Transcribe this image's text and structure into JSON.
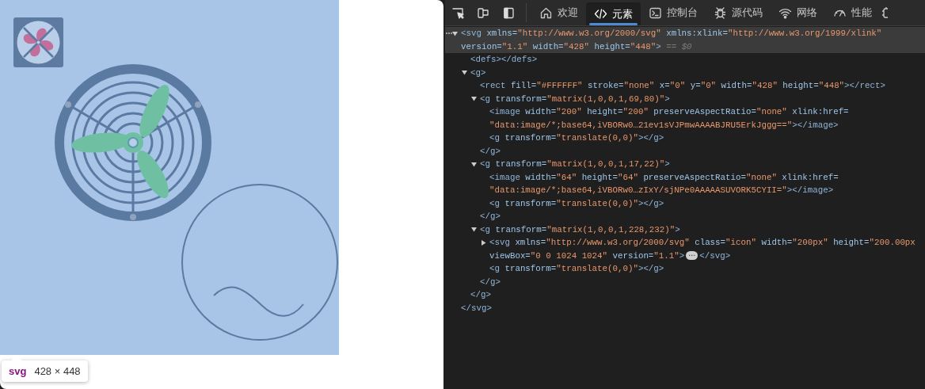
{
  "preview": {
    "tooltip": {
      "tag": "svg",
      "size": "428 × 448"
    }
  },
  "devtools": {
    "tabs": [
      {
        "label": "欢迎",
        "selected": false
      },
      {
        "label": "元素",
        "selected": true
      },
      {
        "label": "控制台",
        "selected": false
      },
      {
        "label": "源代码",
        "selected": false
      },
      {
        "label": "网络",
        "selected": false
      },
      {
        "label": "性能",
        "selected": false
      }
    ],
    "tree": {
      "selected": true,
      "expanded": true,
      "lines": [
        [
          {
            "kind": "tag",
            "text": "<svg"
          },
          {
            "kind": "name",
            "text": "xmlns="
          },
          {
            "kind": "value",
            "text": "\"http://www.w3.org/2000/svg\""
          },
          {
            "kind": "name",
            "text": "xmlns:xlink="
          },
          {
            "kind": "value",
            "text": "\"http://www.w3.org/1999/xlink\""
          }
        ],
        [
          {
            "kind": "name",
            "text": "version="
          },
          {
            "kind": "value",
            "text": "\"1.1\""
          },
          {
            "kind": "name",
            "text": "width="
          },
          {
            "kind": "value",
            "text": "\"428\""
          },
          {
            "kind": "name",
            "text": "height="
          },
          {
            "kind": "value",
            "text": "\"448\""
          },
          {
            "kind": "tag",
            "text": ">"
          },
          {
            "kind": "comment",
            "text": "== $0"
          }
        ]
      ],
      "children": [
        {
          "selected": false,
          "lines": [
            [
              {
                "kind": "tag",
                "text": "<defs"
              },
              {
                "kind": "tag",
                "text": "></defs>"
              }
            ]
          ]
        },
        {
          "selected": false,
          "expanded": true,
          "lines": [
            [
              {
                "kind": "tag",
                "text": "<g"
              },
              {
                "kind": "tag",
                "text": ">"
              }
            ]
          ],
          "children": [
            {
              "selected": false,
              "lines": [
                [
                  {
                    "kind": "tag",
                    "text": "<rect"
                  },
                  {
                    "kind": "name",
                    "text": "fill="
                  },
                  {
                    "kind": "value",
                    "text": "\"#FFFFFF\""
                  },
                  {
                    "kind": "name",
                    "text": "stroke="
                  },
                  {
                    "kind": "value",
                    "text": "\"none\""
                  },
                  {
                    "kind": "name",
                    "text": "x="
                  },
                  {
                    "kind": "value",
                    "text": "\"0\""
                  },
                  {
                    "kind": "name",
                    "text": "y="
                  },
                  {
                    "kind": "value",
                    "text": "\"0\""
                  },
                  {
                    "kind": "name",
                    "text": "width="
                  },
                  {
                    "kind": "value",
                    "text": "\"428\""
                  },
                  {
                    "kind": "name",
                    "text": "height="
                  },
                  {
                    "kind": "value",
                    "text": "\"448\""
                  },
                  {
                    "kind": "tag",
                    "text": "></rect>"
                  }
                ]
              ]
            },
            {
              "selected": false,
              "expanded": true,
              "lines": [
                [
                  {
                    "kind": "tag",
                    "text": "<g"
                  },
                  {
                    "kind": "name",
                    "text": "transform="
                  },
                  {
                    "kind": "value",
                    "text": "\"matrix(1,0,0,1,69,80)\""
                  },
                  {
                    "kind": "tag",
                    "text": ">"
                  }
                ]
              ],
              "children": [
                {
                  "selected": false,
                  "lines": [
                    [
                      {
                        "kind": "tag",
                        "text": "<image"
                      },
                      {
                        "kind": "name",
                        "text": "width="
                      },
                      {
                        "kind": "value",
                        "text": "\"200\""
                      },
                      {
                        "kind": "name",
                        "text": "height="
                      },
                      {
                        "kind": "value",
                        "text": "\"200\""
                      },
                      {
                        "kind": "name",
                        "text": "preserveAspectRatio="
                      },
                      {
                        "kind": "value",
                        "text": "\"none\""
                      },
                      {
                        "kind": "name",
                        "text": "xlink:href="
                      }
                    ],
                    [
                      {
                        "kind": "value",
                        "text": "\"data:image/*;base64,iVBORw0…21ev1sVJPmwAAAABJRU5ErkJggg==\""
                      },
                      {
                        "kind": "tag",
                        "text": "></image>"
                      }
                    ]
                  ]
                },
                {
                  "selected": false,
                  "lines": [
                    [
                      {
                        "kind": "tag",
                        "text": "<g"
                      },
                      {
                        "kind": "name",
                        "text": "transform="
                      },
                      {
                        "kind": "value",
                        "text": "\"translate(0,0)\""
                      },
                      {
                        "kind": "tag",
                        "text": "></g>"
                      }
                    ]
                  ]
                }
              ],
              "closing": [
                {
                  "kind": "tag",
                  "text": "</g>"
                }
              ]
            },
            {
              "selected": false,
              "expanded": true,
              "lines": [
                [
                  {
                    "kind": "tag",
                    "text": "<g"
                  },
                  {
                    "kind": "name",
                    "text": "transform="
                  },
                  {
                    "kind": "value",
                    "text": "\"matrix(1,0,0,1,17,22)\""
                  },
                  {
                    "kind": "tag",
                    "text": ">"
                  }
                ]
              ],
              "children": [
                {
                  "selected": false,
                  "lines": [
                    [
                      {
                        "kind": "tag",
                        "text": "<image"
                      },
                      {
                        "kind": "name",
                        "text": "width="
                      },
                      {
                        "kind": "value",
                        "text": "\"64\""
                      },
                      {
                        "kind": "name",
                        "text": "height="
                      },
                      {
                        "kind": "value",
                        "text": "\"64\""
                      },
                      {
                        "kind": "name",
                        "text": "preserveAspectRatio="
                      },
                      {
                        "kind": "value",
                        "text": "\"none\""
                      },
                      {
                        "kind": "name",
                        "text": "xlink:href="
                      }
                    ],
                    [
                      {
                        "kind": "value",
                        "text": "\"data:image/*;base64,iVBORw0…zIxY/sjNPe0AAAAASUVORK5CYII=\""
                      },
                      {
                        "kind": "tag",
                        "text": "></image>"
                      }
                    ]
                  ]
                },
                {
                  "selected": false,
                  "lines": [
                    [
                      {
                        "kind": "tag",
                        "text": "<g"
                      },
                      {
                        "kind": "name",
                        "text": "transform="
                      },
                      {
                        "kind": "value",
                        "text": "\"translate(0,0)\""
                      },
                      {
                        "kind": "tag",
                        "text": "></g>"
                      }
                    ]
                  ]
                }
              ],
              "closing": [
                {
                  "kind": "tag",
                  "text": "</g>"
                }
              ]
            },
            {
              "selected": false,
              "expanded": true,
              "lines": [
                [
                  {
                    "kind": "tag",
                    "text": "<g"
                  },
                  {
                    "kind": "name",
                    "text": "transform="
                  },
                  {
                    "kind": "value",
                    "text": "\"matrix(1,0,0,1,228,232)\""
                  },
                  {
                    "kind": "tag",
                    "text": ">"
                  }
                ]
              ],
              "children": [
                {
                  "selected": false,
                  "expanded": false,
                  "lines": [
                    [
                      {
                        "kind": "tag",
                        "text": "<svg"
                      },
                      {
                        "kind": "name",
                        "text": "xmlns="
                      },
                      {
                        "kind": "value",
                        "text": "\"http://www.w3.org/2000/svg\""
                      },
                      {
                        "kind": "name",
                        "text": "class="
                      },
                      {
                        "kind": "value",
                        "text": "\"icon\""
                      },
                      {
                        "kind": "name",
                        "text": "width="
                      },
                      {
                        "kind": "value",
                        "text": "\"200px\""
                      },
                      {
                        "kind": "name",
                        "text": "height="
                      },
                      {
                        "kind": "value",
                        "text": "\"200.00px"
                      }
                    ],
                    [
                      {
                        "kind": "name",
                        "text": "viewBox="
                      },
                      {
                        "kind": "value",
                        "text": "\"0 0 1024 1024\""
                      },
                      {
                        "kind": "name",
                        "text": "version="
                      },
                      {
                        "kind": "value",
                        "text": "\"1.1\""
                      },
                      {
                        "kind": "tag",
                        "text": ">"
                      },
                      {
                        "kind": "badge",
                        "text": "⋯"
                      },
                      {
                        "kind": "tag",
                        "text": "</svg>"
                      }
                    ]
                  ]
                },
                {
                  "selected": false,
                  "lines": [
                    [
                      {
                        "kind": "tag",
                        "text": "<g"
                      },
                      {
                        "kind": "name",
                        "text": "transform="
                      },
                      {
                        "kind": "value",
                        "text": "\"translate(0,0)\""
                      },
                      {
                        "kind": "tag",
                        "text": "></g>"
                      }
                    ]
                  ]
                }
              ],
              "closing": [
                {
                  "kind": "tag",
                  "text": "</g>"
                }
              ]
            }
          ],
          "closing": [
            {
              "kind": "tag",
              "text": "</g>"
            }
          ]
        }
      ],
      "closing": [
        {
          "kind": "tag",
          "text": "</svg>"
        }
      ]
    }
  }
}
